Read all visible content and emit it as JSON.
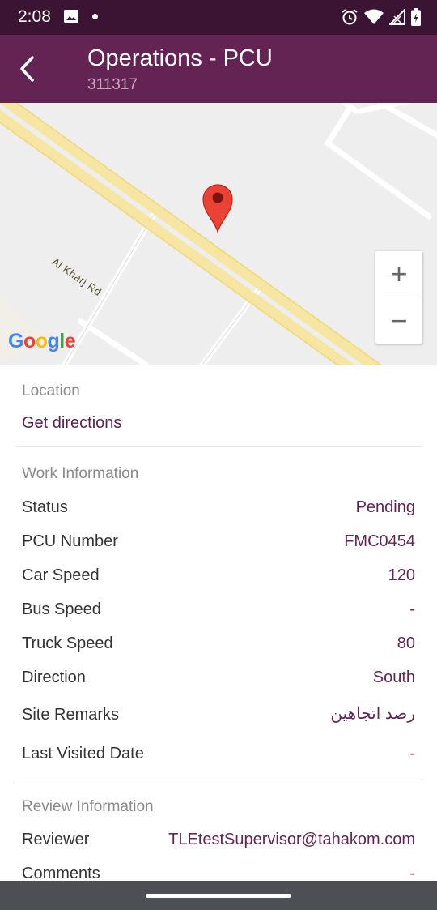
{
  "status_bar": {
    "time": "2:08",
    "icons": [
      "image-icon",
      "dot-icon",
      "alarm-icon",
      "wifi-icon",
      "signal-icon",
      "battery-icon"
    ]
  },
  "app_bar": {
    "back_icon": "arrow-back-icon",
    "title": "Operations - PCU",
    "subtitle": "311317",
    "color": "#632453"
  },
  "map": {
    "road_label": "Al Kharj Rd",
    "zoom_in": "+",
    "zoom_out": "−",
    "logo": {
      "g1": "G",
      "o1": "o",
      "o2": "o",
      "g2": "g",
      "l": "l",
      "e": "e"
    },
    "pin_icon": "map-pin-icon"
  },
  "location": {
    "heading": "Location",
    "get_directions": "Get directions"
  },
  "work_information": {
    "heading": "Work Information",
    "rows": [
      {
        "label": "Status",
        "value": "Pending"
      },
      {
        "label": "PCU Number",
        "value": "FMC0454"
      },
      {
        "label": "Car Speed",
        "value": "120"
      },
      {
        "label": "Bus Speed",
        "value": "-"
      },
      {
        "label": "Truck Speed",
        "value": "80"
      },
      {
        "label": "Direction",
        "value": "South"
      },
      {
        "label": "Site Remarks",
        "value": "رصد اتجاهين"
      },
      {
        "label": "Last Visited Date",
        "value": "-"
      }
    ]
  },
  "review_information": {
    "heading": "Review Information",
    "rows": [
      {
        "label": "Reviewer",
        "value": "TLEtestSupervisor@tahakom.com"
      },
      {
        "label": "Comments",
        "value": "-"
      }
    ]
  }
}
